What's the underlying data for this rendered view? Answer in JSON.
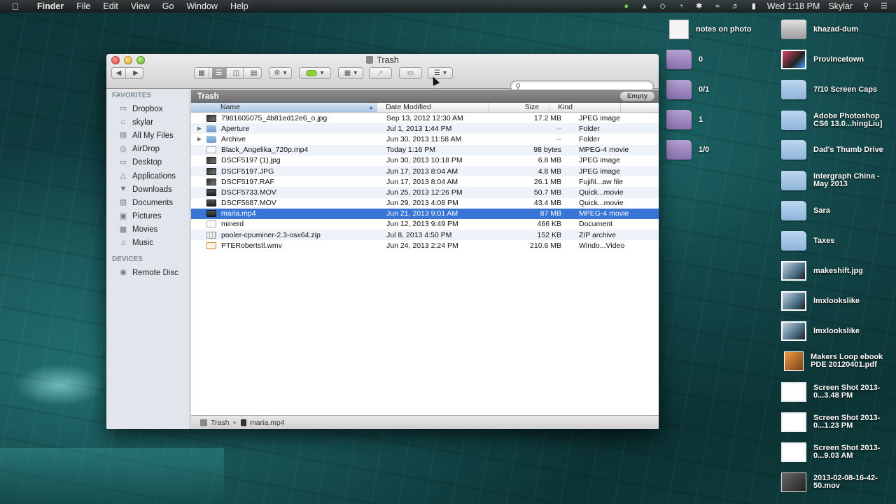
{
  "menubar": {
    "app": "Finder",
    "items": [
      "File",
      "Edit",
      "View",
      "Go",
      "Window",
      "Help"
    ],
    "clock": "Wed 1:18 PM",
    "user": "Skylar"
  },
  "window": {
    "title": "Trash",
    "search_placeholder": ""
  },
  "sidebar": {
    "favorites_header": "FAVORITES",
    "favorites": [
      {
        "label": "Dropbox",
        "icon": "folder-icon"
      },
      {
        "label": "skylar",
        "icon": "home-icon"
      },
      {
        "label": "All My Files",
        "icon": "all-files-icon"
      },
      {
        "label": "AirDrop",
        "icon": "airdrop-icon"
      },
      {
        "label": "Desktop",
        "icon": "desktop-icon"
      },
      {
        "label": "Applications",
        "icon": "applications-icon"
      },
      {
        "label": "Downloads",
        "icon": "downloads-icon"
      },
      {
        "label": "Documents",
        "icon": "documents-icon"
      },
      {
        "label": "Pictures",
        "icon": "pictures-icon"
      },
      {
        "label": "Movies",
        "icon": "movies-icon"
      },
      {
        "label": "Music",
        "icon": "music-icon"
      }
    ],
    "devices_header": "DEVICES",
    "devices": [
      {
        "label": "Remote Disc",
        "icon": "disc-icon"
      }
    ]
  },
  "main": {
    "location": "Trash",
    "empty_label": "Empty",
    "columns": {
      "name": "Name",
      "date": "Date Modified",
      "size": "Size",
      "kind": "Kind"
    },
    "rows": [
      {
        "name": "7981605075_4b81ed12e6_o.jpg",
        "date": "Sep 13, 2012 12:30 AM",
        "size": "17.2 MB",
        "kind": "JPEG image",
        "type": "img"
      },
      {
        "name": "Aperture",
        "date": "Jul 1, 2013 1:44 PM",
        "size": "--",
        "kind": "Folder",
        "type": "folder"
      },
      {
        "name": "Archive",
        "date": "Jun 30, 2013 11:58 AM",
        "size": "--",
        "kind": "Folder",
        "type": "folder"
      },
      {
        "name": "Black_Angelika_720p.mp4",
        "date": "Today 1:16 PM",
        "size": "98 bytes",
        "kind": "MPEG-4 movie",
        "type": "doc"
      },
      {
        "name": "DSCF5197 (1).jpg",
        "date": "Jun 30, 2013 10:18 PM",
        "size": "6.8 MB",
        "kind": "JPEG image",
        "type": "img"
      },
      {
        "name": "DSCF5197.JPG",
        "date": "Jun 17, 2013 8:04 AM",
        "size": "4.8 MB",
        "kind": "JPEG image",
        "type": "img"
      },
      {
        "name": "DSCF5197.RAF",
        "date": "Jun 17, 2013 8:04 AM",
        "size": "26.1 MB",
        "kind": "Fujifil...aw file",
        "type": "img"
      },
      {
        "name": "DSCF5733.MOV",
        "date": "Jun 25, 2013 12:26 PM",
        "size": "50.7 MB",
        "kind": "Quick...movie",
        "type": "movie"
      },
      {
        "name": "DSCF5887.MOV",
        "date": "Jun 29, 2013 4:08 PM",
        "size": "43.4 MB",
        "kind": "Quick...movie",
        "type": "movie"
      },
      {
        "name": "maria.mp4",
        "date": "Jun 21, 2013 9:01 AM",
        "size": "87 MB",
        "kind": "MPEG-4 movie",
        "type": "movie",
        "selected": true
      },
      {
        "name": "minerd",
        "date": "Jun 12, 2013 9:49 PM",
        "size": "466 KB",
        "kind": "Document",
        "type": "doc"
      },
      {
        "name": "pooler-cpuminer-2.3-osx64.zip",
        "date": "Jul 8, 2013 4:50 PM",
        "size": "152 KB",
        "kind": "ZIP archive",
        "type": "zip"
      },
      {
        "name": "PTERobertstl.wmv",
        "date": "Jun 24, 2013 2:24 PM",
        "size": "210.6 MB",
        "kind": "Windo...Video",
        "type": "wmv"
      }
    ]
  },
  "statusbar": {
    "path": [
      "Trash",
      "maria.mp4"
    ]
  },
  "desktop": {
    "col1": [
      {
        "label": "notes on photo",
        "icon": "rtf-document-icon"
      },
      {
        "label": "0",
        "icon": "folder-icon"
      },
      {
        "label": "0/1",
        "icon": "folder-icon"
      },
      {
        "label": "1",
        "icon": "folder-icon"
      },
      {
        "label": "1/0",
        "icon": "folder-icon"
      }
    ],
    "col2": [
      {
        "label": "khazad-dum",
        "icon": "drive-icon"
      },
      {
        "label": "Provincetown",
        "icon": "image-icon"
      },
      {
        "label": "7/10 Screen Caps",
        "icon": "folder-icon"
      },
      {
        "label": "Adobe Photoshop CS6 13.0...hingLiu]",
        "icon": "folder-icon"
      },
      {
        "label": "Dad's Thumb Drive",
        "icon": "folder-icon"
      },
      {
        "label": "Intergraph China - May 2013",
        "icon": "folder-icon"
      },
      {
        "label": "Sara",
        "icon": "folder-icon"
      },
      {
        "label": "Taxes",
        "icon": "folder-icon"
      },
      {
        "label": "makeshift.jpg",
        "icon": "image-icon"
      },
      {
        "label": "lmxlookslike",
        "icon": "image-icon"
      },
      {
        "label": "lmxlookslike",
        "icon": "image-icon"
      },
      {
        "label": "Makers Loop ebook PDE 20120401.pdf",
        "icon": "pdf-icon"
      },
      {
        "label": "Screen Shot 2013-0...3.48 PM",
        "icon": "screenshot-icon"
      },
      {
        "label": "Screen Shot 2013-0...1.23 PM",
        "icon": "screenshot-icon"
      },
      {
        "label": "Screen Shot 2013-0...9.03 AM",
        "icon": "screenshot-icon"
      },
      {
        "label": "2013-02-08-16-42-50.mov",
        "icon": "movie-icon"
      }
    ]
  }
}
